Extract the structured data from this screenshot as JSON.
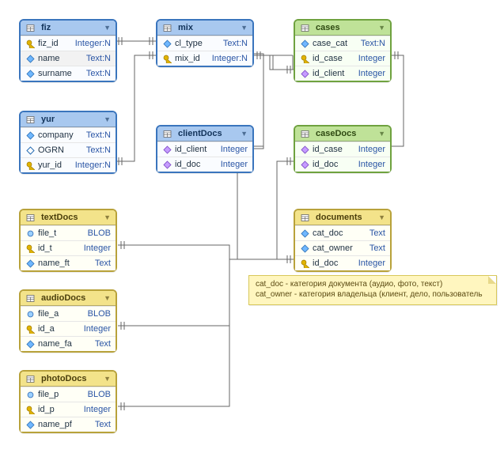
{
  "chart_data": {
    "type": "entity-relationship",
    "tables": [
      {
        "name": "fiz",
        "theme": "blue",
        "columns": [
          [
            "fiz_id",
            "Integer:N",
            "key"
          ],
          [
            "name",
            "Text:N",
            "diamond"
          ],
          [
            "surname",
            "Text:N",
            "diamond"
          ]
        ]
      },
      {
        "name": "mix",
        "theme": "blue",
        "columns": [
          [
            "cl_type",
            "Text:N",
            "diamond"
          ],
          [
            "mix_id",
            "Integer:N",
            "key"
          ]
        ]
      },
      {
        "name": "cases",
        "theme": "green",
        "columns": [
          [
            "case_cat",
            "Text:N",
            "diamond"
          ],
          [
            "id_case",
            "Integer",
            "key"
          ],
          [
            "id_client",
            "Integer",
            "fdiamond"
          ]
        ]
      },
      {
        "name": "yur",
        "theme": "blue",
        "columns": [
          [
            "company",
            "Text:N",
            "diamond"
          ],
          [
            "OGRN",
            "Text:N",
            "diamond_o"
          ],
          [
            "yur_id",
            "Integer:N",
            "key"
          ]
        ]
      },
      {
        "name": "clientDocs",
        "theme": "blue",
        "columns": [
          [
            "id_client",
            "Integer",
            "fdiamond"
          ],
          [
            "id_doc",
            "Integer",
            "fdiamond"
          ]
        ]
      },
      {
        "name": "caseDocs",
        "theme": "green",
        "columns": [
          [
            "id_case",
            "Integer",
            "fdiamond"
          ],
          [
            "id_doc",
            "Integer",
            "fdiamond"
          ]
        ]
      },
      {
        "name": "textDocs",
        "theme": "yellow",
        "columns": [
          [
            "file_t",
            "BLOB",
            "dot"
          ],
          [
            "id_t",
            "Integer",
            "key"
          ],
          [
            "name_ft",
            "Text",
            "diamond"
          ]
        ]
      },
      {
        "name": "documents",
        "theme": "yellow",
        "columns": [
          [
            "cat_doc",
            "Text",
            "diamond"
          ],
          [
            "cat_owner",
            "Text",
            "diamond"
          ],
          [
            "id_doc",
            "Integer",
            "key"
          ]
        ]
      },
      {
        "name": "audioDocs",
        "theme": "yellow",
        "columns": [
          [
            "file_a",
            "BLOB",
            "dot"
          ],
          [
            "id_a",
            "Integer",
            "key"
          ],
          [
            "name_fa",
            "Text",
            "diamond"
          ]
        ]
      },
      {
        "name": "photoDocs",
        "theme": "yellow",
        "columns": [
          [
            "file_p",
            "BLOB",
            "dot"
          ],
          [
            "id_p",
            "Integer",
            "key"
          ],
          [
            "name_pf",
            "Text",
            "diamond"
          ]
        ]
      }
    ],
    "relationships": [
      [
        "fiz.fiz_id",
        "mix.mix_id"
      ],
      [
        "yur.yur_id",
        "mix.mix_id"
      ],
      [
        "mix.mix_id",
        "cases.id_client"
      ],
      [
        "mix.mix_id",
        "clientDocs.id_client"
      ],
      [
        "cases.id_case",
        "caseDocs.id_case"
      ],
      [
        "documents.id_doc",
        "clientDocs.id_doc"
      ],
      [
        "documents.id_doc",
        "caseDocs.id_doc"
      ],
      [
        "documents.id_doc",
        "textDocs.id_t"
      ],
      [
        "documents.id_doc",
        "audioDocs.id_a"
      ],
      [
        "documents.id_doc",
        "photoDocs.id_p"
      ]
    ],
    "note": "cat_doc - категория документа (аудио, фото, текст); cat_owner - категория владельца (клиент, дело, пользователь"
  },
  "note": {
    "line1": "cat_doc - категория документа (аудио, фото, текст)",
    "line2": "cat_owner - категория владельца (клиент, дело, пользователь"
  },
  "t": {
    "fiz": {
      "title": "fiz",
      "c0n": "fiz_id",
      "c0t": "Integer:N",
      "c1n": "name",
      "c1t": "Text:N",
      "c2n": "surname",
      "c2t": "Text:N"
    },
    "mix": {
      "title": "mix",
      "c0n": "cl_type",
      "c0t": "Text:N",
      "c1n": "mix_id",
      "c1t": "Integer:N"
    },
    "cases": {
      "title": "cases",
      "c0n": "case_cat",
      "c0t": "Text:N",
      "c1n": "id_case",
      "c1t": "Integer",
      "c2n": "id_client",
      "c2t": "Integer"
    },
    "yur": {
      "title": "yur",
      "c0n": "company",
      "c0t": "Text:N",
      "c1n": "OGRN",
      "c1t": "Text:N",
      "c2n": "yur_id",
      "c2t": "Integer:N"
    },
    "clientDocs": {
      "title": "clientDocs",
      "c0n": "id_client",
      "c0t": "Integer",
      "c1n": "id_doc",
      "c1t": "Integer"
    },
    "caseDocs": {
      "title": "caseDocs",
      "c0n": "id_case",
      "c0t": "Integer",
      "c1n": "id_doc",
      "c1t": "Integer"
    },
    "textDocs": {
      "title": "textDocs",
      "c0n": "file_t",
      "c0t": "BLOB",
      "c1n": "id_t",
      "c1t": "Integer",
      "c2n": "name_ft",
      "c2t": "Text"
    },
    "documents": {
      "title": "documents",
      "c0n": "cat_doc",
      "c0t": "Text",
      "c1n": "cat_owner",
      "c1t": "Text",
      "c2n": "id_doc",
      "c2t": "Integer"
    },
    "audioDocs": {
      "title": "audioDocs",
      "c0n": "file_a",
      "c0t": "BLOB",
      "c1n": "id_a",
      "c1t": "Integer",
      "c2n": "name_fa",
      "c2t": "Text"
    },
    "photoDocs": {
      "title": "photoDocs",
      "c0n": "file_p",
      "c0t": "BLOB",
      "c1n": "id_p",
      "c1t": "Integer",
      "c2n": "name_pf",
      "c2t": "Text"
    }
  }
}
